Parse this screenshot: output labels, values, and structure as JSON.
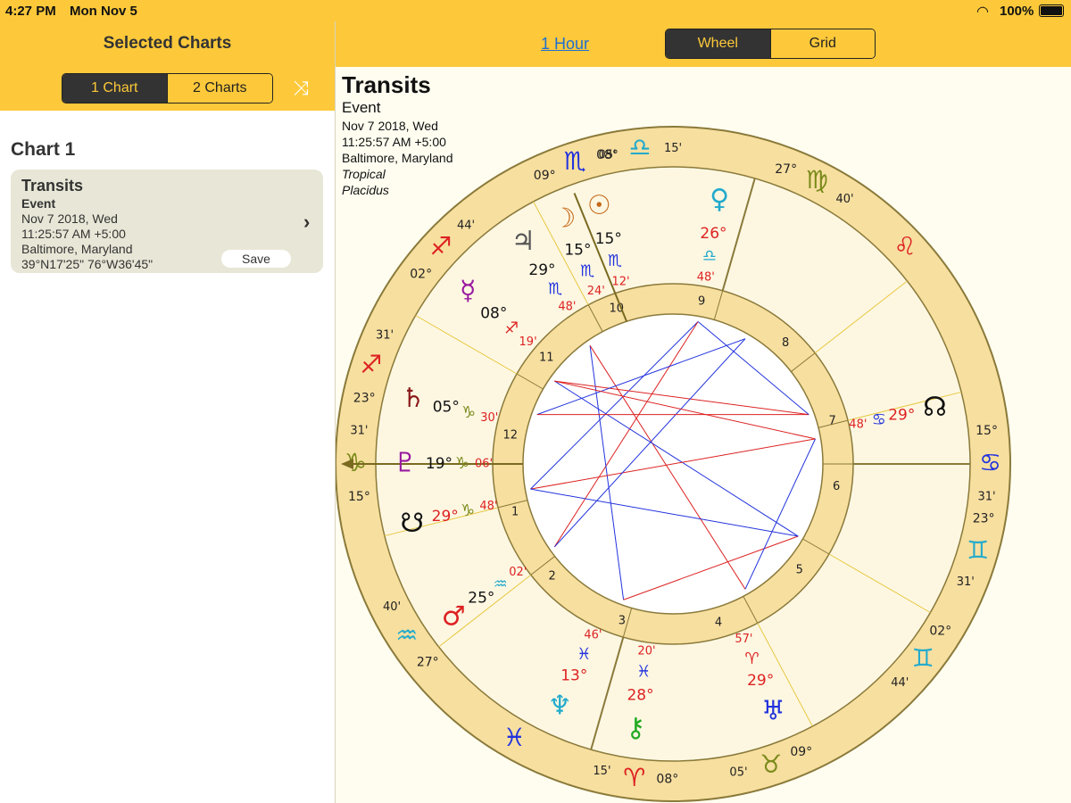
{
  "status": {
    "time": "4:27 PM",
    "date": "Mon Nov 5",
    "battery": "100%"
  },
  "left": {
    "title": "Selected Charts",
    "seg_one": "1 Chart",
    "seg_two": "2 Charts",
    "chart_heading": "Chart 1",
    "card": {
      "title": "Transits",
      "type": "Event",
      "date": "Nov 7 2018, Wed",
      "time": "11:25:57 AM +5:00",
      "place": "Baltimore, Maryland",
      "coords": "39°N17'25\" 76°W36'45\"",
      "save": "Save"
    }
  },
  "right": {
    "hour_link": "1 Hour",
    "seg_wheel": "Wheel",
    "seg_grid": "Grid",
    "info": {
      "title": "Transits",
      "type": "Event",
      "date": "Nov 7 2018, Wed",
      "time": "11:25:57 AM +5:00",
      "place": "Baltimore, Maryland",
      "zodiac": "Tropical",
      "houses": "Placidus"
    }
  },
  "colors": {
    "accent": "#fdc93a",
    "ring": "#f7dfa0",
    "ring_line": "#8a7a3a",
    "blue_aspect": "#2233dd",
    "red_aspect": "#dd2222"
  },
  "wheel": {
    "signs": [
      {
        "glyph": "♎",
        "color": "#22aacc",
        "deg": "08°",
        "min": "15'"
      },
      {
        "glyph": "♍",
        "color": "#7a8a1a",
        "deg": "27°",
        "min": "40'"
      },
      {
        "glyph": "♌",
        "color": "#dd2222",
        "deg": "",
        "min": ""
      },
      {
        "glyph": "♋",
        "color": "#2233dd",
        "deg": "15°",
        "min": "31'"
      },
      {
        "glyph": "♊",
        "color": "#22aacc",
        "deg": "23°",
        "min": "31'"
      },
      {
        "glyph": "♊",
        "color": "#22aacc",
        "deg": "02°",
        "min": "44'"
      },
      {
        "glyph": "♉",
        "color": "#7a8a1a",
        "deg": "09°",
        "min": "05'"
      },
      {
        "glyph": "♈",
        "color": "#dd2222",
        "deg": "08°",
        "min": "15'"
      },
      {
        "glyph": "♓",
        "color": "#2233dd",
        "deg": "",
        "min": ""
      },
      {
        "glyph": "♒",
        "color": "#22aacc",
        "deg": "27°",
        "min": "40'"
      },
      {
        "glyph": "♑",
        "color": "#7a8a1a",
        "deg": "15°",
        "min": "31'"
      },
      {
        "glyph": "♐",
        "color": "#dd2222",
        "deg": "23°",
        "min": "31'"
      },
      {
        "glyph": "♐",
        "color": "#dd2222",
        "deg": "02°",
        "min": "44'"
      },
      {
        "glyph": "♏",
        "color": "#2233dd",
        "deg": "09°",
        "min": "05'"
      }
    ],
    "houses": [
      "1",
      "2",
      "3",
      "4",
      "5",
      "6",
      "7",
      "8",
      "9",
      "10",
      "11",
      "12"
    ],
    "planets": [
      {
        "name": "venus",
        "glyph": "♀",
        "color": "#22aacc",
        "deg": "26°",
        "degcolor": "#dd2222",
        "sign": "♎",
        "signcolor": "#22aacc",
        "min": "48'"
      },
      {
        "name": "moon",
        "glyph": "☽",
        "color": "#c46a1a",
        "deg": "15°",
        "degcolor": "#111",
        "sign": "♏",
        "signcolor": "#2233dd",
        "min": "24'"
      },
      {
        "name": "sun",
        "glyph": "☉",
        "color": "#c46a1a",
        "deg": "15°",
        "degcolor": "#111",
        "sign": "♏",
        "signcolor": "#2233dd",
        "min": "12'"
      },
      {
        "name": "jupiter",
        "glyph": "♃",
        "color": "#555",
        "deg": "29°",
        "degcolor": "#111",
        "sign": "♏",
        "signcolor": "#2233dd",
        "min": "48'"
      },
      {
        "name": "mercury",
        "glyph": "☿",
        "color": "#9a1aa0",
        "deg": "08°",
        "degcolor": "#111",
        "sign": "♐",
        "signcolor": "#dd2222",
        "min": "19'"
      },
      {
        "name": "saturn",
        "glyph": "♄",
        "color": "#8a1a1a",
        "deg": "05°",
        "degcolor": "#111",
        "sign": "♑",
        "signcolor": "#7a8a1a",
        "min": "30'"
      },
      {
        "name": "pluto",
        "glyph": "♇",
        "color": "#9a1aa0",
        "deg": "19°",
        "degcolor": "#111",
        "sign": "♑",
        "signcolor": "#7a8a1a",
        "min": "06'"
      },
      {
        "name": "south-node",
        "glyph": "☋",
        "color": "#111",
        "deg": "29°",
        "degcolor": "#dd2222",
        "sign": "♑",
        "signcolor": "#7a8a1a",
        "min": "48'"
      },
      {
        "name": "mars",
        "glyph": "♂",
        "color": "#dd2222",
        "deg": "25°",
        "degcolor": "#111",
        "sign": "♒",
        "signcolor": "#22aacc",
        "min": "02'"
      },
      {
        "name": "neptune",
        "glyph": "♆",
        "color": "#22aacc",
        "deg": "13°",
        "degcolor": "#dd2222",
        "sign": "♓",
        "signcolor": "#2233dd",
        "min": "46'"
      },
      {
        "name": "chiron",
        "glyph": "⚷",
        "color": "#22aa22",
        "deg": "28°",
        "degcolor": "#dd2222",
        "sign": "♓",
        "signcolor": "#2233dd",
        "min": "20'"
      },
      {
        "name": "uranus",
        "glyph": "♅",
        "color": "#2233dd",
        "deg": "29°",
        "degcolor": "#dd2222",
        "sign": "♈",
        "signcolor": "#dd2222",
        "min": "57'"
      },
      {
        "name": "north-node",
        "glyph": "☊",
        "color": "#111",
        "deg": "29°",
        "degcolor": "#dd2222",
        "sign": "♋",
        "signcolor": "#2233dd",
        "min": "48'"
      }
    ]
  }
}
